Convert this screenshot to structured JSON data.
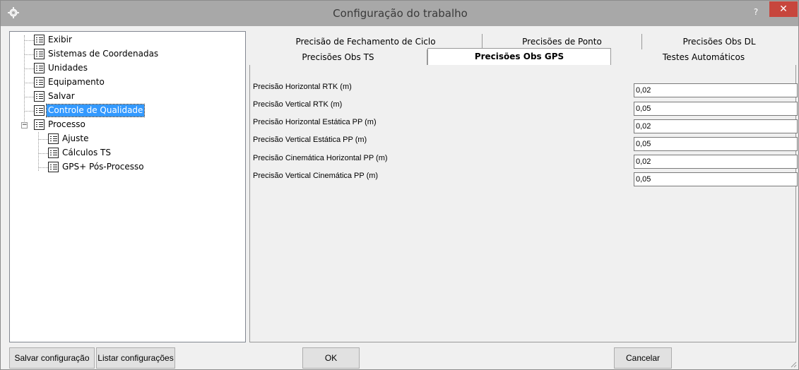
{
  "window": {
    "title": "Configuração do trabalho",
    "help_label": "?",
    "close_label": "✕"
  },
  "tree": {
    "items": [
      {
        "label": "Exibir"
      },
      {
        "label": "Sistemas de Coordenadas"
      },
      {
        "label": "Unidades"
      },
      {
        "label": "Equipamento"
      },
      {
        "label": "Salvar"
      },
      {
        "label": "Controle de Qualidade",
        "selected": true
      },
      {
        "label": "Processo",
        "expander": "−"
      },
      {
        "label": "Ajuste"
      },
      {
        "label": "Cálculos TS"
      },
      {
        "label": "GPS+ Pós-Processo"
      }
    ]
  },
  "tabs": {
    "row1": [
      {
        "label": "Precisão de Fechamento de Ciclo"
      },
      {
        "label": "Precisões de Ponto"
      },
      {
        "label": "Precisões Obs DL"
      }
    ],
    "row2": [
      {
        "label": "Precisões Obs TS"
      },
      {
        "label": "Precisões Obs GPS",
        "active": true
      },
      {
        "label": "Testes Automáticos"
      }
    ]
  },
  "fields": [
    {
      "label": "Precisão Horizontal RTK (m)",
      "value": "0,02"
    },
    {
      "label": "Precisão Vertical RTK (m)",
      "value": "0,05"
    },
    {
      "label": "Precisão Horizontal Estática PP (m)",
      "value": "0,02"
    },
    {
      "label": "Precisão Vertical Estática PP (m)",
      "value": "0,05"
    },
    {
      "label": "Precisão Cinemática Horizontal PP (m)",
      "value": "0,02"
    },
    {
      "label": "Precisão Vertical Cinemática PP (m)",
      "value": "0,05"
    }
  ],
  "buttons": {
    "save_config": "Salvar configuração",
    "list_configs": "Listar configurações",
    "ok": "OK",
    "cancel": "Cancelar"
  },
  "colors": {
    "titlebar": "#a8a8a8",
    "close": "#c7463d",
    "selection": "#3399ff"
  }
}
